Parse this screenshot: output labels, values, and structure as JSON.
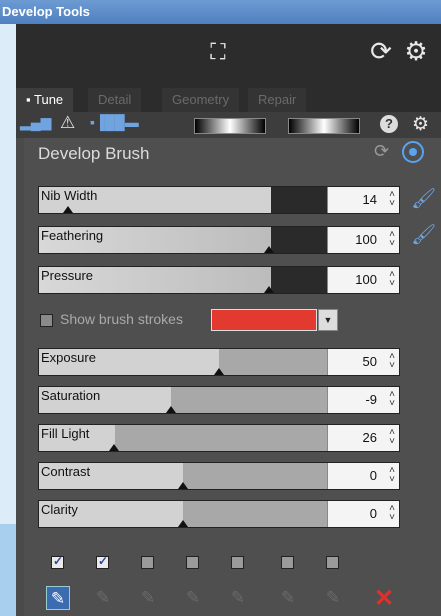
{
  "window": {
    "title": "Develop Tools"
  },
  "tabs": [
    {
      "label": "Tune",
      "active": true
    },
    {
      "label": "Detail",
      "active": false
    },
    {
      "label": "Geometry",
      "active": false
    },
    {
      "label": "Repair",
      "active": false
    }
  ],
  "section": {
    "title": "Develop Brush"
  },
  "brush_sliders": [
    {
      "label": "Nib Width",
      "value": "14",
      "level": 0.08
    },
    {
      "label": "Feathering",
      "value": "100",
      "level": 1.0
    },
    {
      "label": "Pressure",
      "value": "100",
      "level": 1.0
    }
  ],
  "show_strokes": {
    "label": "Show brush strokes",
    "checked": false,
    "color": "#e23a2e"
  },
  "adjust_sliders": [
    {
      "label": "Exposure",
      "value": "50",
      "level": 0.5
    },
    {
      "label": "Saturation",
      "value": "-9",
      "level": 0.26
    },
    {
      "label": "Fill Light",
      "value": "26",
      "level": 0.2
    },
    {
      "label": "Contrast",
      "value": "0",
      "level": 0.0
    },
    {
      "label": "Clarity",
      "value": "0",
      "level": 0.0
    }
  ],
  "layer_checks": [
    true,
    true,
    false,
    false,
    false,
    false,
    false
  ],
  "colors": {
    "accent": "#3b6cb0",
    "delete": "#e0302a"
  }
}
